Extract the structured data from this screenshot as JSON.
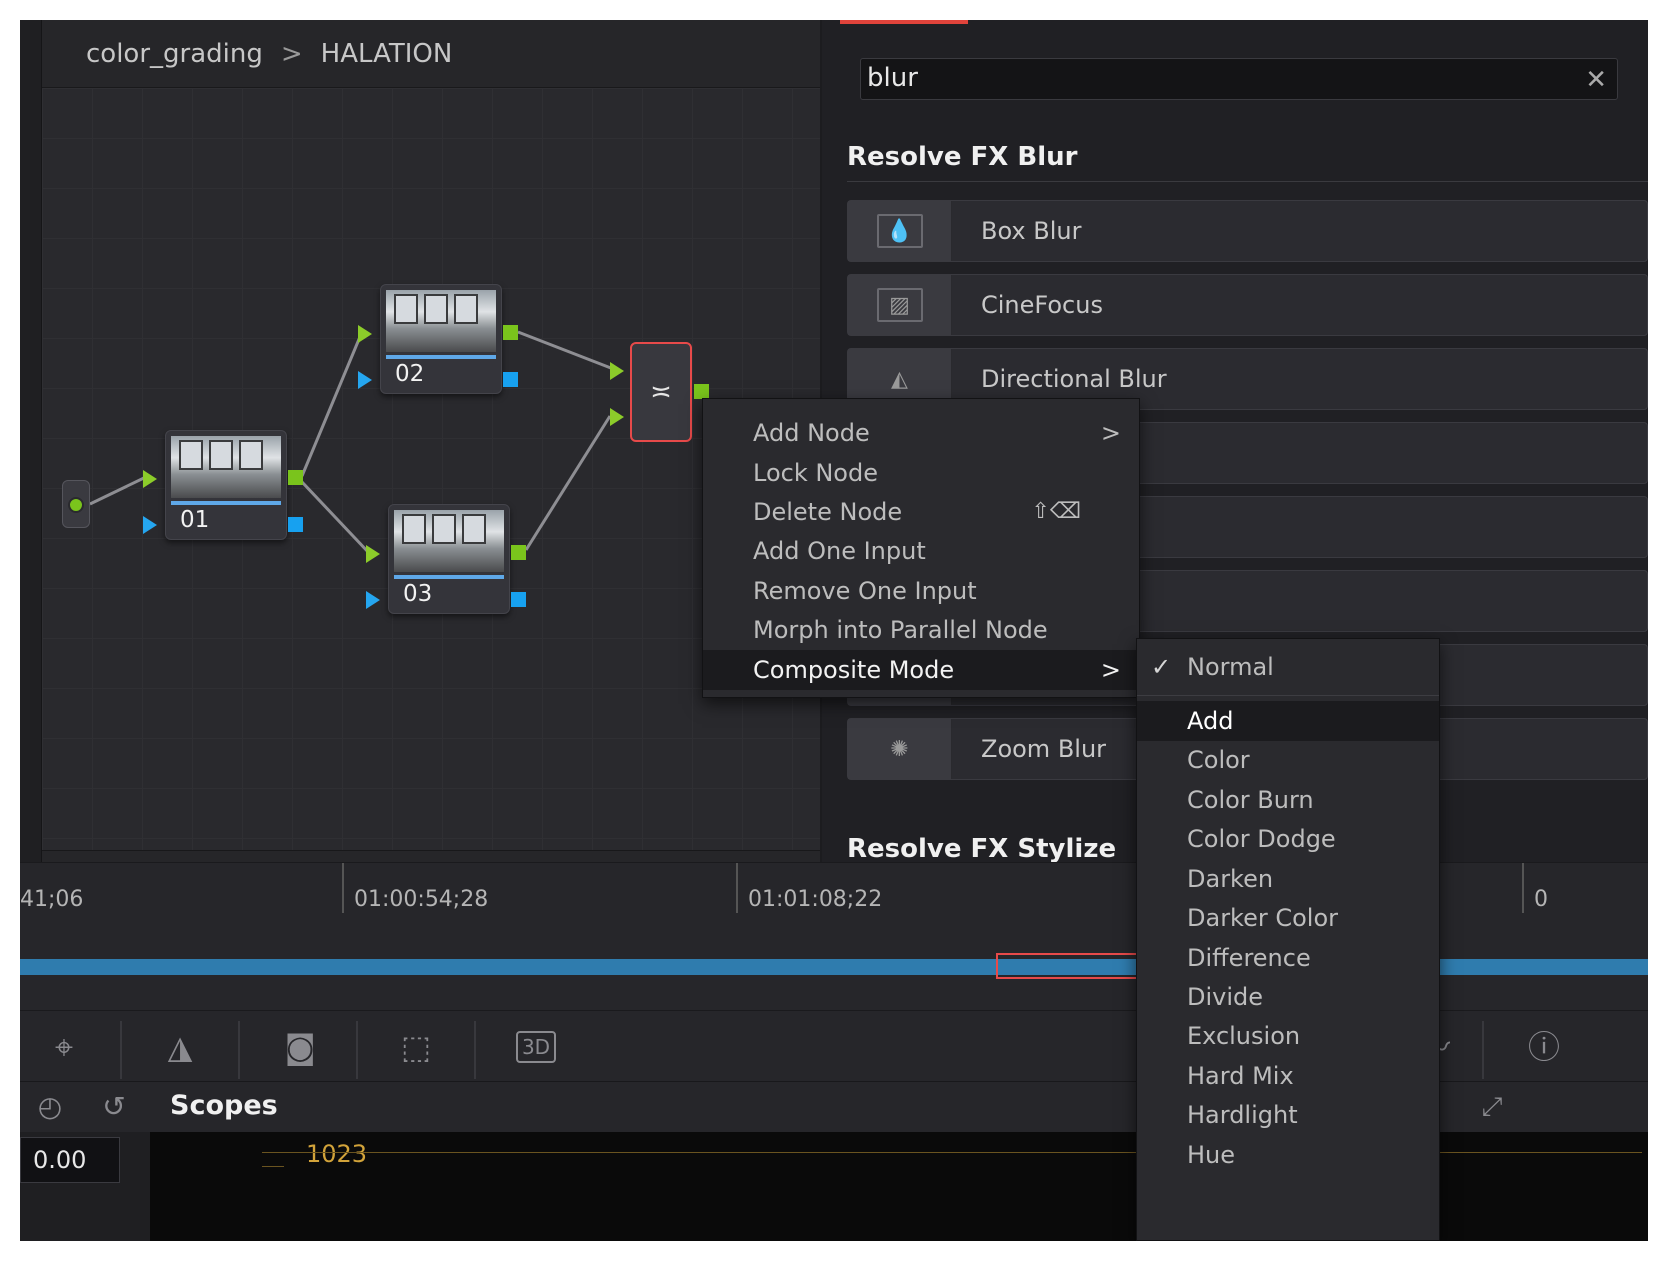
{
  "breadcrumb": {
    "parent": "color_grading",
    "separator": ">",
    "current": "HALATION"
  },
  "nodes": [
    {
      "label": "01"
    },
    {
      "label": "02"
    },
    {
      "label": "03"
    }
  ],
  "mixer_icon": "≍",
  "search": {
    "value": "blur",
    "clear_icon": "✕"
  },
  "fx_groups": {
    "blur_title": "Resolve FX Blur",
    "stylize_title": "Resolve FX Stylize",
    "items": [
      {
        "name": "Box Blur"
      },
      {
        "name": "CineFocus"
      },
      {
        "name": "Directional Blur"
      },
      {
        "name": "Zoom Blur"
      }
    ]
  },
  "timeline": {
    "timecodes": [
      "41;06",
      "01:00:54;28",
      "01:01:08;22",
      "0"
    ]
  },
  "context_menu": {
    "items": [
      {
        "label": "Add Node",
        "arrow": ">"
      },
      {
        "label": "Lock Node"
      },
      {
        "label": "Delete Node",
        "shortcut": "⇧⌫"
      },
      {
        "label": "Add One Input"
      },
      {
        "label": "Remove One Input"
      },
      {
        "label": "Morph into Parallel Node"
      },
      {
        "label": "Composite Mode",
        "arrow": ">"
      }
    ]
  },
  "composite_submenu": {
    "check": "✓",
    "selected": "Normal",
    "items": [
      "Add",
      "Color",
      "Color Burn",
      "Color Dodge",
      "Darken",
      "Darker Color",
      "Difference",
      "Divide",
      "Exclusion",
      "Hard Mix",
      "Hardlight",
      "Hue"
    ],
    "highlighted": "Add"
  },
  "toolbar": {
    "threed_label": "3D"
  },
  "scopes": {
    "title": "Scopes",
    "value": "0.00",
    "scale_top": "1023"
  },
  "colors": {
    "accent_red": "#e74a4a",
    "port_green": "#7ac41c",
    "port_blue": "#17a1f0",
    "clip_blue": "#2f7cae"
  }
}
